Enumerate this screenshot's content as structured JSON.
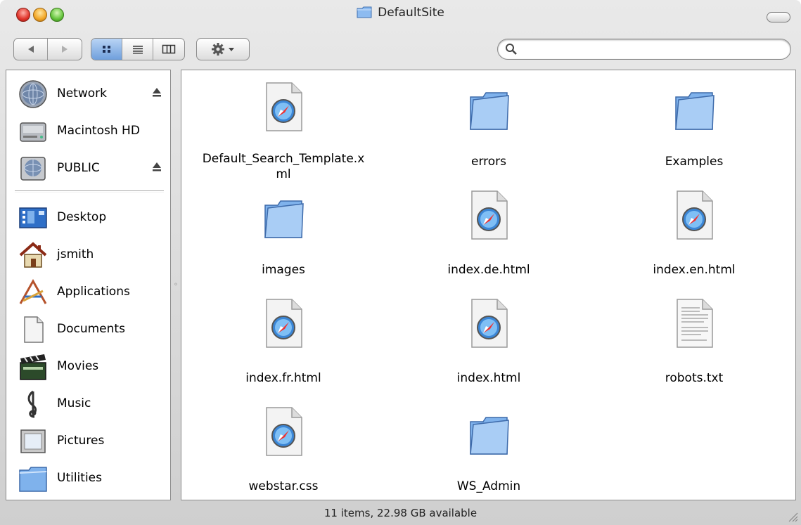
{
  "window": {
    "title": "DefaultSite"
  },
  "toolbar": {
    "search": {
      "value": "",
      "placeholder": ""
    },
    "icons": [
      "back-arrow-icon",
      "forward-arrow-icon",
      "icon-view-icon",
      "list-view-icon",
      "column-view-icon",
      "gear-icon",
      "search-icon"
    ]
  },
  "sidebar": {
    "items": [
      {
        "label": "Network",
        "icon": "network-globe-icon",
        "eject": true
      },
      {
        "label": "Macintosh HD",
        "icon": "hard-drive-icon",
        "eject": false
      },
      {
        "label": "PUBLIC",
        "icon": "network-volume-icon",
        "eject": true
      },
      {
        "label": "Desktop",
        "icon": "desktop-icon",
        "eject": false
      },
      {
        "label": "jsmith",
        "icon": "home-icon",
        "eject": false
      },
      {
        "label": "Applications",
        "icon": "applications-icon",
        "eject": false
      },
      {
        "label": "Documents",
        "icon": "documents-icon",
        "eject": false
      },
      {
        "label": "Movies",
        "icon": "movies-clapper-icon",
        "eject": false
      },
      {
        "label": "Music",
        "icon": "music-clef-icon",
        "eject": false
      },
      {
        "label": "Pictures",
        "icon": "pictures-frame-icon",
        "eject": false
      },
      {
        "label": "Utilities",
        "icon": "folder-icon",
        "eject": false
      }
    ]
  },
  "files": [
    {
      "name": "Default_Search_Template.x\nml",
      "type": "safari-document-icon"
    },
    {
      "name": "errors",
      "type": "folder-icon"
    },
    {
      "name": "Examples",
      "type": "folder-icon"
    },
    {
      "name": "images",
      "type": "folder-icon"
    },
    {
      "name": "index.de.html",
      "type": "safari-document-icon"
    },
    {
      "name": "index.en.html",
      "type": "safari-document-icon"
    },
    {
      "name": "index.fr.html",
      "type": "safari-document-icon"
    },
    {
      "name": "index.html",
      "type": "safari-document-icon"
    },
    {
      "name": "robots.txt",
      "type": "text-document-icon"
    },
    {
      "name": "webstar.css",
      "type": "safari-document-icon"
    },
    {
      "name": "WS_Admin",
      "type": "folder-icon"
    }
  ],
  "status": {
    "text": "11 items, 22.98 GB available"
  },
  "colors": {
    "folder_blue": "#7fb2ec",
    "selected_view": "#6f9fdc"
  }
}
